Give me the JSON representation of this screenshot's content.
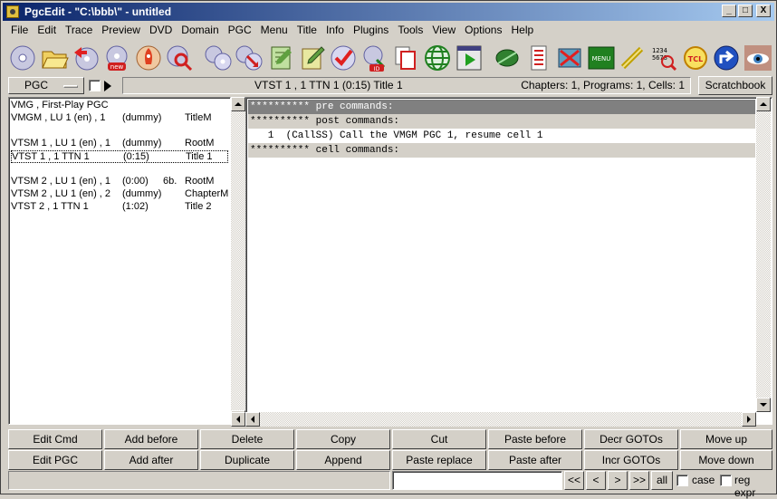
{
  "window": {
    "title": "PgcEdit -   \"C:\\bbb\\\" - untitled",
    "controls": [
      "_",
      "□",
      "X"
    ]
  },
  "menu": [
    "File",
    "Edit",
    "Trace",
    "Preview",
    "DVD",
    "Domain",
    "PGC",
    "Menu",
    "Title",
    "Info",
    "Plugins",
    "Tools",
    "View",
    "Options",
    "Help"
  ],
  "toolbar": {
    "icons": [
      "disc-open-icon",
      "folder-open-icon",
      "disc-back-icon",
      "disc-new-icon",
      "rocket-icon",
      "disc-search-icon",
      "discs-icon",
      "discs-arrow-icon",
      "note-icon",
      "note-pencil-icon",
      "disc-check-icon",
      "disc-id-icon",
      "copy-pages-icon",
      "globe-icon",
      "play-grid-icon",
      "leaf-icon",
      "checklist-icon",
      "film-cross-icon",
      "menu-icon",
      "chain-icon",
      "numbers-search-icon",
      "tcl-icon",
      "navigation-icon",
      "eye-icon"
    ],
    "menu_label": "MENU",
    "tcl_label": "TCL",
    "new_label": "new",
    "id_label": "ID"
  },
  "status_row": {
    "pgc_button": "PGC",
    "center_text": "VTST 1 , 1    TTN 1  (0:15)  Title 1",
    "right_text": "Chapters: 1,  Programs: 1,  Cells: 1",
    "scratchbook": "Scratchbook"
  },
  "pgc_list": [
    {
      "c1": "VMG , First-Play PGC",
      "c2": "",
      "c3": "",
      "c4": ""
    },
    {
      "c1": "VMGM , LU 1 (en) , 1",
      "c2": "(dummy)",
      "c3": "",
      "c4": "TitleM"
    },
    {
      "c1": "",
      "c2": "",
      "c3": "",
      "c4": ""
    },
    {
      "c1": "VTSM 1 , LU 1 (en) , 1",
      "c2": "(dummy)",
      "c3": "",
      "c4": "RootM"
    },
    {
      "c1": "VTST 1 , 1         TTN 1",
      "c2": "(0:15)",
      "c3": "",
      "c4": "Title 1"
    },
    {
      "c1": "",
      "c2": "",
      "c3": "",
      "c4": ""
    },
    {
      "c1": "VTSM 2 , LU 1 (en) , 1",
      "c2": "(0:00)",
      "c3": "6b.",
      "c4": "RootM"
    },
    {
      "c1": "VTSM 2 , LU 1 (en) , 2",
      "c2": "(dummy)",
      "c3": "",
      "c4": "ChapterM"
    },
    {
      "c1": "VTST 2 , 1         TTN 1",
      "c2": "(1:02)",
      "c3": "",
      "c4": "Title 2"
    }
  ],
  "commands": [
    {
      "text": "********** pre commands:",
      "style": "dark"
    },
    {
      "text": "********** post commands:",
      "style": "lite"
    },
    {
      "text": "   1  (CallSS) Call the VMGM PGC 1, resume cell 1",
      "style": "plain"
    },
    {
      "text": "********** cell commands:",
      "style": "lite"
    }
  ],
  "buttons_row1": [
    "Edit Cmd",
    "Add before",
    "Delete",
    "Copy",
    "Cut",
    "Paste before",
    "Decr GOTOs",
    "Move up"
  ],
  "buttons_row2": [
    "Edit PGC",
    "Add after",
    "Duplicate",
    "Append",
    "Paste replace",
    "Paste after",
    "Incr GOTOs",
    "Move down"
  ],
  "find": {
    "value": "",
    "nav": [
      "<<",
      "<",
      ">",
      ">>"
    ],
    "all": "all",
    "case": "case",
    "regexpr": "reg expr"
  }
}
